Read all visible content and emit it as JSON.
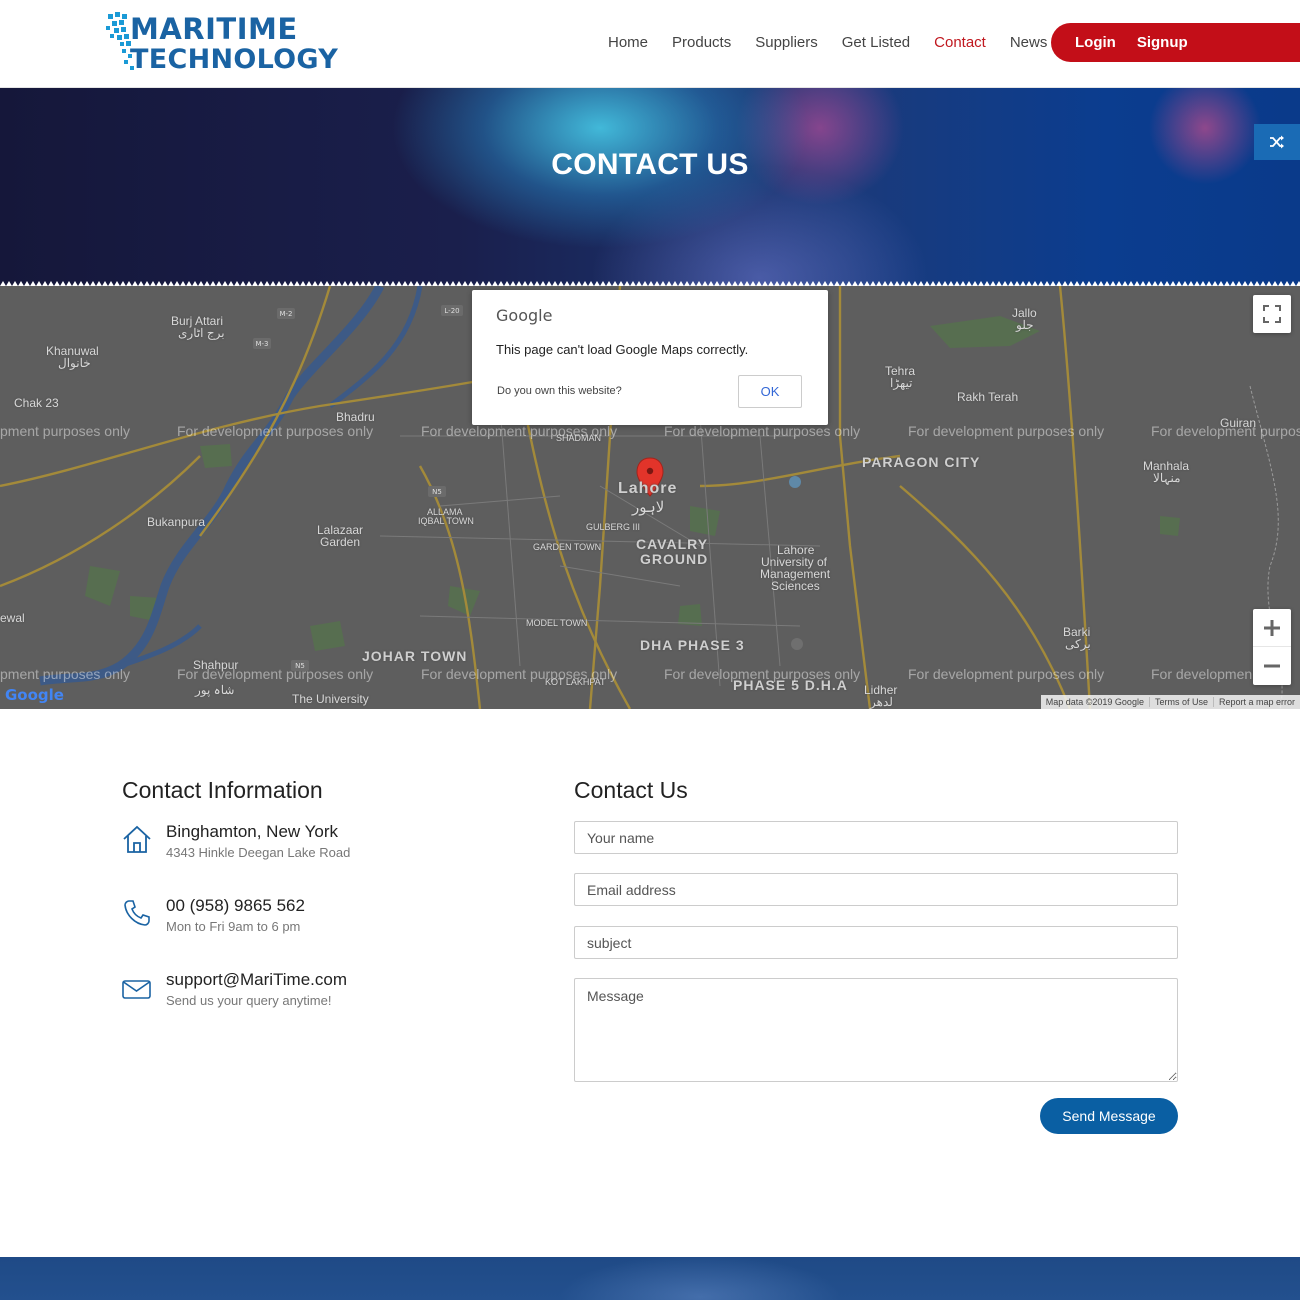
{
  "header": {
    "logo_line1": "MARITIME",
    "logo_line2": "TECHNOLOGY",
    "nav": [
      {
        "label": "Home"
      },
      {
        "label": "Products"
      },
      {
        "label": "Suppliers"
      },
      {
        "label": "Get Listed"
      },
      {
        "label": "Contact",
        "active": true
      },
      {
        "label": "News"
      }
    ],
    "login_label": "Login",
    "signup_label": "Signup"
  },
  "banner": {
    "title": "CONTACT US"
  },
  "map": {
    "watermark": "For development purposes only",
    "watermark_left_cut": "pment purposes only",
    "watermark_right_cut_1": "For development purpos",
    "watermark_right_cut_2": "For developmen",
    "places": {
      "khanuwal": "Khanuwal",
      "khanuwal_ur": "خانوال",
      "burj_attari": "Burj Attari",
      "burj_attari_ur": "برج اٹاری",
      "chak23": "Chak 23",
      "bhadru": "Bhadru",
      "bukanpura": "Bukanpura",
      "lalazaar": "Lalazaar",
      "garden": "Garden",
      "lahore": "Lahore",
      "lahore_ur": "لاہور",
      "cavalry": "CAVALRY",
      "ground": "GROUND",
      "lums1": "Lahore",
      "lums2": "University of",
      "lums3": "Management",
      "lums4": "Sciences",
      "paragon": "PARAGON CITY",
      "tehra": "Tehra",
      "tehra_ur": "تیھڑا",
      "rakh_terah": "Rakh Terah",
      "jallo": "Jallo",
      "jallo_ur": "جلو",
      "guiran": "Guiran",
      "manhala": "Manhala",
      "manhala_ur": "منہالا",
      "johar": "JOHAR TOWN",
      "dha3": "DHA PHASE 3",
      "dha5": "PHASE 5 D.H.A",
      "barki": "Barki",
      "barki_ur": "برکی",
      "lidher": "Lidher",
      "lidher_ur": "لدھر",
      "shahpur": "Shahpur",
      "shahpur_ur": "شاہ پور",
      "the_university": "The University",
      "ewal": "ewal",
      "allama": "ALLAMA",
      "iqbal_town": "IQBAL TOWN",
      "gulberg": "GULBERG III",
      "garden_town": "GARDEN TOWN",
      "model_town": "MODEL TOWN",
      "kot_lakhpat": "KOT LAKHPAT",
      "shadman": "SHADMAN"
    },
    "google_logo": "Google",
    "footer": [
      "Map data ©2019 Google",
      "Terms of Use",
      "Report a map error"
    ],
    "dialog": {
      "title": "Google",
      "message": "This page can't load Google Maps correctly.",
      "own_question": "Do you own this website?",
      "ok_label": "OK"
    }
  },
  "contact_info": {
    "title": "Contact Information",
    "items": [
      {
        "icon": "home-icon",
        "main": "Binghamton, New York",
        "sub": "4343 Hinkle Deegan Lake Road"
      },
      {
        "icon": "phone-icon",
        "main": "00 (958) 9865 562",
        "sub": "Mon to Fri 9am to 6 pm"
      },
      {
        "icon": "mail-icon",
        "main": "support@MariTime.com",
        "sub": "Send us your query anytime!"
      }
    ]
  },
  "contact_form": {
    "title": "Contact Us",
    "name_placeholder": "Your name",
    "email_placeholder": "Email address",
    "subject_placeholder": "subject",
    "message_placeholder": "Message",
    "send_label": "Send Message"
  },
  "colors": {
    "brand_blue": "#1a63a3",
    "accent_red": "#c30e18",
    "button_blue": "#0a5fa3"
  }
}
